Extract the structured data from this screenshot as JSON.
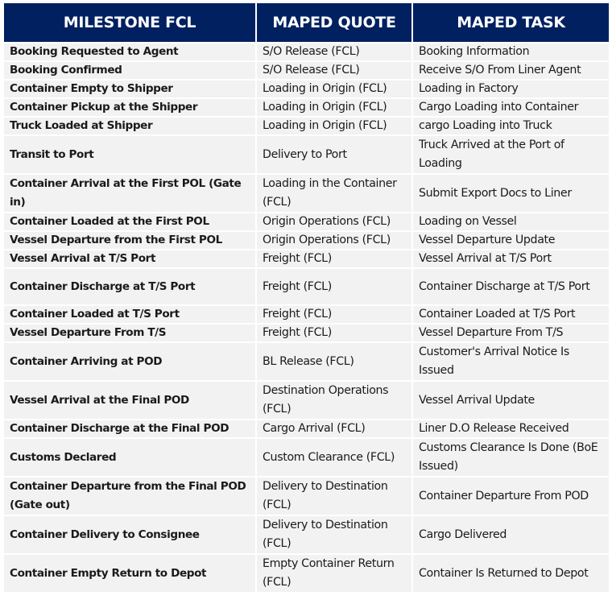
{
  "table": {
    "headers": [
      "MILESTONE FCL",
      "MAPED QUOTE",
      "MAPED TASK"
    ],
    "rows": [
      {
        "milestone": "Booking Requested to Agent",
        "quote": "S/O Release (FCL)",
        "task": "Booking Information",
        "lines": 1
      },
      {
        "milestone": "Booking Confirmed",
        "quote": "S/O Release (FCL)",
        "task": "Receive S/O From Liner Agent",
        "lines": 1
      },
      {
        "milestone": "Container Empty to Shipper",
        "quote": "Loading in Origin (FCL)",
        "task": "Loading in Factory",
        "lines": 1
      },
      {
        "milestone": "Container Pickup at the Shipper",
        "quote": "Loading in Origin (FCL)",
        "task": "Cargo Loading into Container",
        "lines": 1
      },
      {
        "milestone": "Truck Loaded at Shipper",
        "quote": "Loading in Origin (FCL)",
        "task": "cargo Loading into Truck",
        "lines": 1
      },
      {
        "milestone": "Transit to Port",
        "quote": "Delivery to Port",
        "task": "Truck Arrived at the Port of Loading",
        "lines": 2
      },
      {
        "milestone": "Container Arrival at the First POL (Gate in)",
        "quote": "Loading in the Container (FCL)",
        "task": "Submit Export Docs to Liner",
        "lines": 2
      },
      {
        "milestone": "Container Loaded at the First POL",
        "quote": "Origin Operations (FCL)",
        "task": "Loading on Vessel",
        "lines": 1
      },
      {
        "milestone": "Vessel Departure from the First POL",
        "quote": "Origin Operations (FCL)",
        "task": "Vessel Departure Update",
        "lines": 1
      },
      {
        "milestone": "Vessel Arrival at T/S Port",
        "quote": "Freight (FCL)",
        "task": "Vessel Arrival at T/S Port",
        "lines": 1
      },
      {
        "milestone": "Container Discharge at T/S Port",
        "quote": "Freight (FCL)",
        "task": "Container Discharge at T/S Port",
        "lines": 2
      },
      {
        "milestone": "Container Loaded at T/S Port",
        "quote": "Freight (FCL)",
        "task": "Container Loaded at T/S Port",
        "lines": 1
      },
      {
        "milestone": "Vessel Departure From T/S",
        "quote": "Freight (FCL)",
        "task": "Vessel Departure From T/S",
        "lines": 1
      },
      {
        "milestone": "Container Arriving at POD",
        "quote": "BL Release (FCL)",
        "task": "Customer's Arrival Notice Is Issued",
        "lines": 2
      },
      {
        "milestone": "Vessel Arrival at the Final POD",
        "quote": "Destination Operations (FCL)",
        "task": "Vessel Arrival Update",
        "lines": 2
      },
      {
        "milestone": "Container Discharge at the Final POD",
        "quote": "Cargo Arrival (FCL)",
        "task": "Liner D.O Release Received",
        "lines": 1
      },
      {
        "milestone": "Customs Declared",
        "quote": "Custom Clearance (FCL)",
        "task": "Customs Clearance Is Done (BoE Issued)",
        "lines": 2
      },
      {
        "milestone": "Container Departure from the Final POD (Gate out)",
        "quote": "Delivery to Destination (FCL)",
        "task": "Container Departure From POD",
        "lines": 2
      },
      {
        "milestone": "Container Delivery to Consignee",
        "quote": "Delivery to Destination (FCL)",
        "task": "Cargo Delivered",
        "lines": 2
      },
      {
        "milestone": "Container Empty Return to Depot",
        "quote": "Empty Container Return (FCL)",
        "task": "Container Is Returned to Depot",
        "lines": 2
      }
    ]
  },
  "colors": {
    "header_bg": "#002060",
    "header_text": "#ffffff",
    "row_bg": "#f2f2f2"
  }
}
